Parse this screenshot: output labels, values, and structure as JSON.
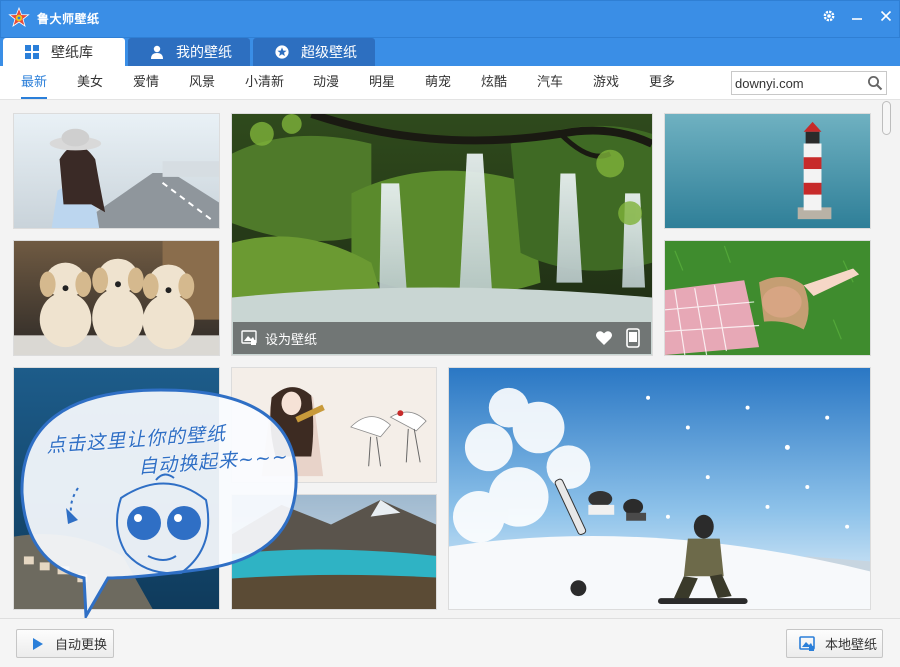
{
  "app": {
    "title": "鲁大师壁纸"
  },
  "tabs": [
    {
      "label": "壁纸库",
      "icon": "grid-icon",
      "active": true
    },
    {
      "label": "我的壁纸",
      "icon": "user-icon",
      "active": false
    },
    {
      "label": "超级壁纸",
      "icon": "star-icon",
      "active": false
    }
  ],
  "categories": [
    "最新",
    "美女",
    "爱情",
    "风景",
    "小清新",
    "动漫",
    "明星",
    "萌宠",
    "炫酷",
    "汽车",
    "游戏",
    "更多"
  ],
  "active_category": "最新",
  "search": {
    "value": "downyi.com"
  },
  "featured": {
    "set_label": "设为壁纸"
  },
  "tooltip_bubble": {
    "line1": "点击这里让你的壁纸",
    "line2": "自动换起来~~~"
  },
  "bottom": {
    "auto_change_label": "自动更换",
    "local_wallpaper_label": "本地壁纸"
  },
  "colors": {
    "brand_blue": "#3a8ee6",
    "accent_blue": "#2b7fd9"
  }
}
